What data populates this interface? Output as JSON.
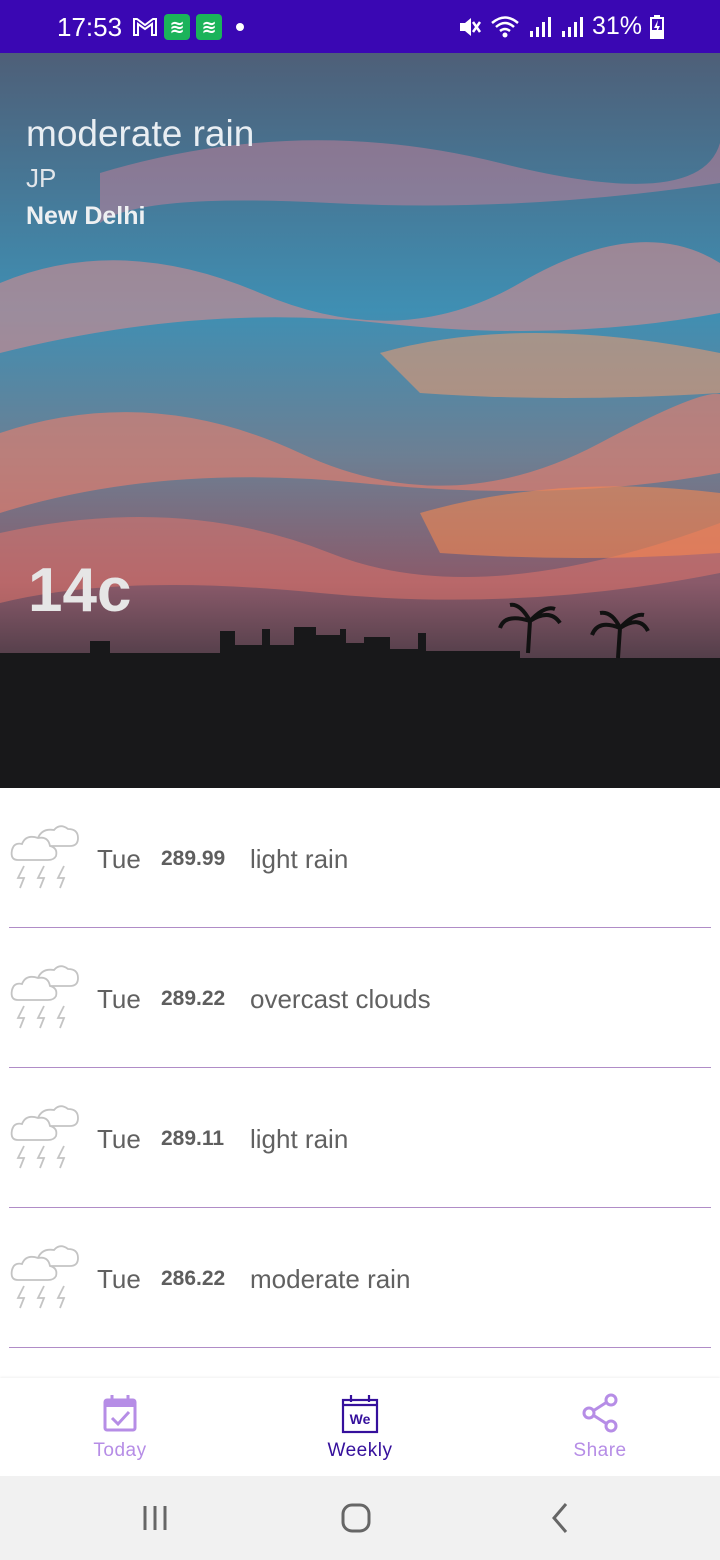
{
  "status_bar": {
    "time": "17:53",
    "battery": "31%",
    "background_color": "#3a07b3",
    "icons": [
      "gmail-icon",
      "app-notification-icon",
      "app-notification-icon",
      "notification-dot",
      "mute-icon",
      "wifi-icon",
      "signal-icon",
      "signal-icon",
      "battery-charging-icon"
    ]
  },
  "hero": {
    "description": "moderate rain",
    "country": "JP",
    "city": "New Delhi",
    "temperature": "14c"
  },
  "forecast": [
    {
      "day": "Tue",
      "temp": "289.99",
      "condition": "light rain",
      "icon": "cloud-storm-icon"
    },
    {
      "day": "Tue",
      "temp": "289.22",
      "condition": "overcast clouds",
      "icon": "cloud-storm-icon"
    },
    {
      "day": "Tue",
      "temp": "289.11",
      "condition": "light rain",
      "icon": "cloud-storm-icon"
    },
    {
      "day": "Tue",
      "temp": "286.22",
      "condition": "moderate rain",
      "icon": "cloud-storm-icon"
    }
  ],
  "bottom_nav": {
    "today": "Today",
    "weekly": "Weekly",
    "weekly_icon_text": "We",
    "share": "Share",
    "active": "Weekly",
    "active_color": "#35109c",
    "inactive_color": "#b68de6"
  },
  "system_nav": [
    "recent-apps-icon",
    "home-icon",
    "back-icon"
  ]
}
